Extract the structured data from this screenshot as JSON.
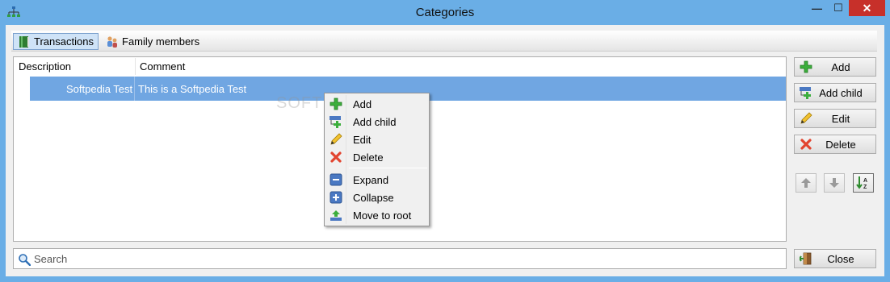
{
  "window": {
    "title": "Categories",
    "minimize_label": "—",
    "maximize_label": "☐",
    "close_label": "✕"
  },
  "tabs": [
    {
      "label": "Transactions",
      "icon": "book-icon",
      "active": true
    },
    {
      "label": "Family members",
      "icon": "family-icon",
      "active": false
    }
  ],
  "tree": {
    "columns": [
      "Description",
      "Comment"
    ],
    "rows": [
      {
        "description": "Softpedia Test",
        "comment": "This is a Softpedia Test",
        "selected": true
      }
    ]
  },
  "buttons": {
    "add": "Add",
    "add_child": "Add child",
    "edit": "Edit",
    "delete": "Delete",
    "close": "Close"
  },
  "search": {
    "placeholder": "Search",
    "value": ""
  },
  "context_menu": {
    "items": [
      {
        "label": "Add",
        "icon": "plus-icon"
      },
      {
        "label": "Add child",
        "icon": "add-child-icon"
      },
      {
        "label": "Edit",
        "icon": "pencil-icon"
      },
      {
        "label": "Delete",
        "icon": "delete-x-icon"
      },
      {
        "label": "Expand",
        "icon": "expand-icon"
      },
      {
        "label": "Collapse",
        "icon": "collapse-icon"
      },
      {
        "label": "Move to root",
        "icon": "move-to-root-icon"
      }
    ]
  },
  "watermark": "SOFTPEDIA",
  "colors": {
    "titlebar": "#6aaee6",
    "selection": "#70a6e2",
    "close_button": "#c7302a",
    "add_green": "#3cae3c",
    "delete_red": "#e2442f"
  }
}
